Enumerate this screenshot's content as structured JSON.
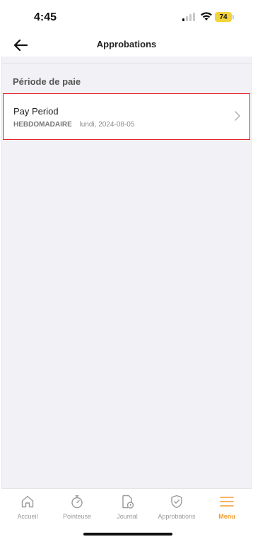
{
  "status_bar": {
    "time": "4:45",
    "battery_level": "74",
    "icons": [
      "signal-icon",
      "wifi-icon",
      "battery-icon"
    ]
  },
  "header": {
    "title": "Approbations",
    "back_icon": "arrow-left-icon"
  },
  "section": {
    "title": "Période de paie"
  },
  "pay_periods": [
    {
      "name": "Pay Period",
      "type": "HEBDOMADAIRE",
      "date": "lundi, 2024-08-05",
      "chevron_icon": "chevron-right-icon"
    }
  ],
  "tab_bar": {
    "active": "Menu",
    "accent_color": "#f39a2b",
    "items": [
      {
        "label": "Accueil",
        "icon": "home-icon"
      },
      {
        "label": "Pointeuse",
        "icon": "stopwatch-icon"
      },
      {
        "label": "Journal",
        "icon": "document-clock-icon"
      },
      {
        "label": "Approbations",
        "icon": "shield-check-icon"
      },
      {
        "label": "Menu",
        "icon": "menu-icon"
      }
    ]
  }
}
